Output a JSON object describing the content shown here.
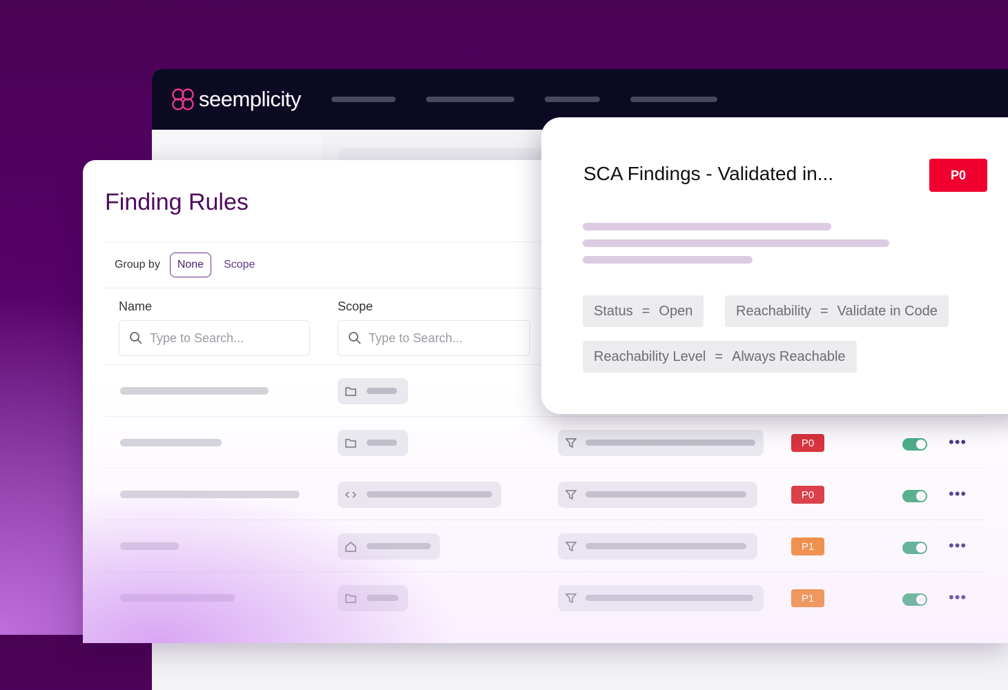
{
  "app": {
    "logo_text": "seemplicity",
    "brand_color": "#e8388a",
    "header_color": "#0c0a23"
  },
  "panel": {
    "title": "Finding Rules",
    "group_by": {
      "label": "Group by",
      "options": [
        "None",
        "Scope"
      ],
      "selected": "None"
    },
    "columns": [
      {
        "header": "Name",
        "placeholder": "Type to Search..."
      },
      {
        "header": "Scope",
        "placeholder": "Type to Search..."
      }
    ],
    "rows": [
      {
        "scope_icon": "folder-icon",
        "priority": "",
        "enabled": null
      },
      {
        "scope_icon": "folder-icon",
        "priority": "P0",
        "enabled": true
      },
      {
        "scope_icon": "code-icon",
        "priority": "P0",
        "enabled": true
      },
      {
        "scope_icon": "home-icon",
        "priority": "P1",
        "enabled": true
      },
      {
        "scope_icon": "folder-icon",
        "priority": "P1",
        "enabled": true
      }
    ],
    "priority_colors": {
      "P0": "#d7262d",
      "P1": "#ef7e1f"
    }
  },
  "popup": {
    "title": "SCA Findings - Validated in...",
    "priority": "P0",
    "priority_color": "#f0002e",
    "filters": [
      {
        "field": "Status",
        "op": "=",
        "value": "Open"
      },
      {
        "field": "Reachability",
        "op": "=",
        "value": "Validate in Code"
      },
      {
        "field": "Reachability Level",
        "op": "=",
        "value": "Always Reachable"
      }
    ]
  }
}
